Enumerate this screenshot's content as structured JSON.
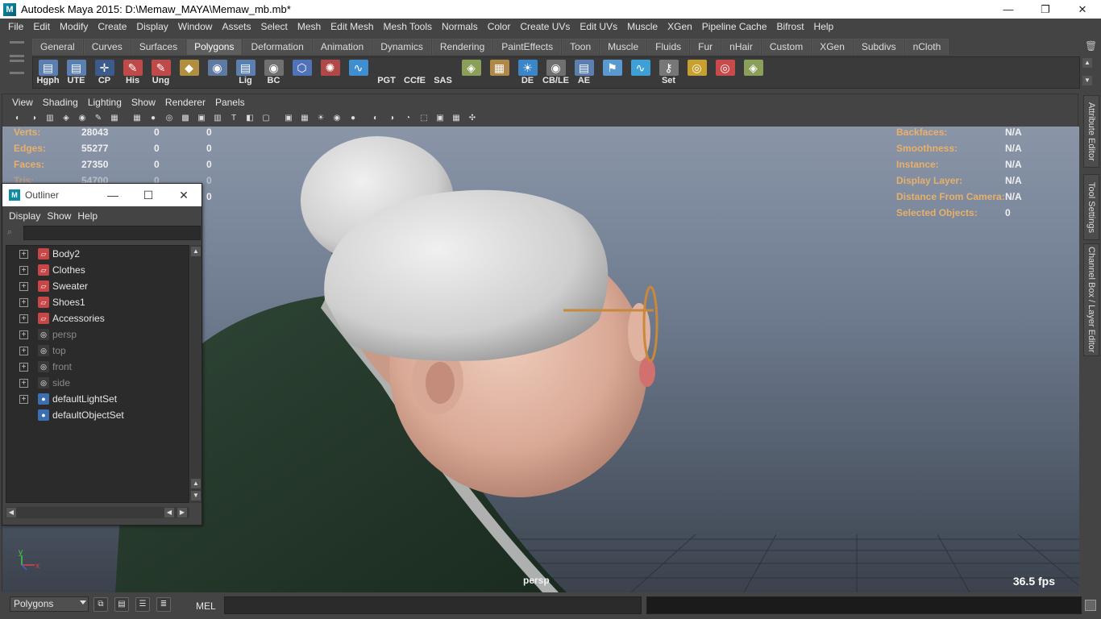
{
  "window": {
    "title": "Autodesk Maya 2015: D:\\Memaw_MAYA\\Memaw_mb.mb*",
    "logo_letter": "M",
    "minimize": "—",
    "restore": "❐",
    "close": "✕"
  },
  "main_menu": [
    "File",
    "Edit",
    "Modify",
    "Create",
    "Display",
    "Window",
    "Assets",
    "Select",
    "Mesh",
    "Edit Mesh",
    "Mesh Tools",
    "Normals",
    "Color",
    "Create UVs",
    "Edit UVs",
    "Muscle",
    "XGen",
    "Pipeline Cache",
    "Bifrost",
    "Help"
  ],
  "shelf": {
    "active_tab": "Polygons",
    "tabs": [
      "General",
      "Curves",
      "Surfaces",
      "Polygons",
      "Deformation",
      "Animation",
      "Dynamics",
      "Rendering",
      "PaintEffects",
      "Toon",
      "Muscle",
      "Fluids",
      "Fur",
      "nHair",
      "Custom",
      "XGen",
      "Subdivs",
      "nCloth"
    ],
    "buttons": [
      {
        "label": "Hgph",
        "glyph": "▤",
        "color": "#5a7fb0"
      },
      {
        "label": "UTE",
        "glyph": "▤",
        "color": "#5a7fb0"
      },
      {
        "label": "CP",
        "glyph": "✛",
        "color": "#3c5a8a"
      },
      {
        "label": "His",
        "glyph": "✎",
        "color": "#c04a4a"
      },
      {
        "label": "Ung",
        "glyph": "✎",
        "color": "#c04a4a"
      },
      {
        "label": "",
        "glyph": "◆",
        "color": "#b09040"
      },
      {
        "label": "",
        "glyph": "◉",
        "color": "#5f7aa0"
      },
      {
        "label": "Lig",
        "glyph": "▤",
        "color": "#5a7fb0"
      },
      {
        "label": "BC",
        "glyph": "◉",
        "color": "#707070"
      },
      {
        "label": "",
        "glyph": "⬡",
        "color": "#4f72b8"
      },
      {
        "label": "",
        "glyph": "✺",
        "color": "#b04848"
      },
      {
        "label": "",
        "glyph": "∿",
        "color": "#3f8fd0"
      },
      {
        "label": "PGT",
        "glyph": "",
        "color": "#3a3a3a"
      },
      {
        "label": "CCfE",
        "glyph": "",
        "color": "#3a3a3a"
      },
      {
        "label": "SAS",
        "glyph": "",
        "color": "#3a3a3a"
      },
      {
        "label": "",
        "glyph": "◈",
        "color": "#8aa05a"
      },
      {
        "label": "",
        "glyph": "▦",
        "color": "#b0884a"
      },
      {
        "label": "DE",
        "glyph": "☀",
        "color": "#3a86c8"
      },
      {
        "label": "CB/LE",
        "glyph": "◉",
        "color": "#707070"
      },
      {
        "label": "AE",
        "glyph": "▤",
        "color": "#5a7fb0"
      },
      {
        "label": "",
        "glyph": "⚑",
        "color": "#5a9ad0"
      },
      {
        "label": "",
        "glyph": "∿",
        "color": "#3fa0d8"
      },
      {
        "label": "Set",
        "glyph": "⚷",
        "color": "#777777"
      },
      {
        "label": "",
        "glyph": "◎",
        "color": "#c8a030"
      },
      {
        "label": "",
        "glyph": "◎",
        "color": "#c84a4a"
      },
      {
        "label": "",
        "glyph": "◈",
        "color": "#8aa05a"
      }
    ],
    "trash_icon": "🗑"
  },
  "viewport": {
    "menu": [
      "View",
      "Shading",
      "Lighting",
      "Show",
      "Renderer",
      "Panels"
    ],
    "toolbar_icons": [
      "◐",
      "◑",
      "▥",
      "◈",
      "◉",
      "✎",
      "▦",
      "▦",
      "●",
      "◎",
      "▩",
      "▣",
      "▥",
      "T",
      "◧",
      "▢",
      "▣",
      "▦",
      "☀",
      "◉",
      "●",
      "◐",
      "◑",
      "◔",
      "⬚",
      "▣",
      "▦",
      "✣"
    ],
    "hud_left": [
      {
        "label": "Verts:",
        "v1": "28043",
        "v2": "0",
        "v3": "0"
      },
      {
        "label": "Edges:",
        "v1": "55277",
        "v2": "0",
        "v3": "0"
      },
      {
        "label": "Faces:",
        "v1": "27350",
        "v2": "0",
        "v3": "0"
      },
      {
        "label": "Tris:",
        "v1": "54700",
        "v2": "0",
        "v3": "0"
      },
      {
        "label": "",
        "v1": "",
        "v2": "",
        "v3": "0"
      }
    ],
    "hud_right": [
      {
        "label": "Backfaces:",
        "value": "N/A"
      },
      {
        "label": "Smoothness:",
        "value": "N/A"
      },
      {
        "label": "Instance:",
        "value": "N/A"
      },
      {
        "label": "Display Layer:",
        "value": "N/A"
      },
      {
        "label": "Distance From Camera:",
        "value": "N/A"
      },
      {
        "label": "Selected Objects:",
        "value": "0"
      }
    ],
    "camera": "persp",
    "fps": "36.5 fps",
    "axis_y": "y",
    "axis_x": "x"
  },
  "right_dock": [
    "Attribute Editor",
    "Tool Settings",
    "Channel Box / Layer Editor"
  ],
  "outliner": {
    "title": "Outliner",
    "logo_letter": "M",
    "minimize": "—",
    "maximize": "☐",
    "close": "✕",
    "menu": [
      "Display",
      "Show",
      "Help"
    ],
    "search_value": "",
    "search_icon": "⌕",
    "items": [
      {
        "name": "Body2",
        "type": "mesh",
        "expandable": true,
        "dim": false
      },
      {
        "name": "Clothes",
        "type": "mesh",
        "expandable": true,
        "dim": false
      },
      {
        "name": "Sweater",
        "type": "mesh",
        "expandable": true,
        "dim": false
      },
      {
        "name": "Shoes1",
        "type": "mesh",
        "expandable": true,
        "dim": false
      },
      {
        "name": "Accessories",
        "type": "mesh",
        "expandable": true,
        "dim": false
      },
      {
        "name": "persp",
        "type": "camera",
        "expandable": true,
        "dim": true
      },
      {
        "name": "top",
        "type": "camera",
        "expandable": true,
        "dim": true
      },
      {
        "name": "front",
        "type": "camera",
        "expandable": true,
        "dim": true
      },
      {
        "name": "side",
        "type": "camera",
        "expandable": true,
        "dim": true
      },
      {
        "name": "defaultLightSet",
        "type": "set",
        "expandable": true,
        "dim": false
      },
      {
        "name": "defaultObjectSet",
        "type": "set",
        "expandable": false,
        "dim": false
      }
    ]
  },
  "command_line": {
    "mode": "Polygons",
    "language": "MEL",
    "input_value": "",
    "icons": [
      "⧉",
      "▤",
      "☰",
      "≣"
    ]
  },
  "colors": {
    "hud_label": "#e8b06a",
    "hud_value": "#f0f0f0",
    "shelf_bg": "#3a3a3a",
    "ui_bg": "#444444",
    "sweater": "#24382a",
    "skin": "#e2b8a6",
    "hair": "#d9d9d9"
  }
}
